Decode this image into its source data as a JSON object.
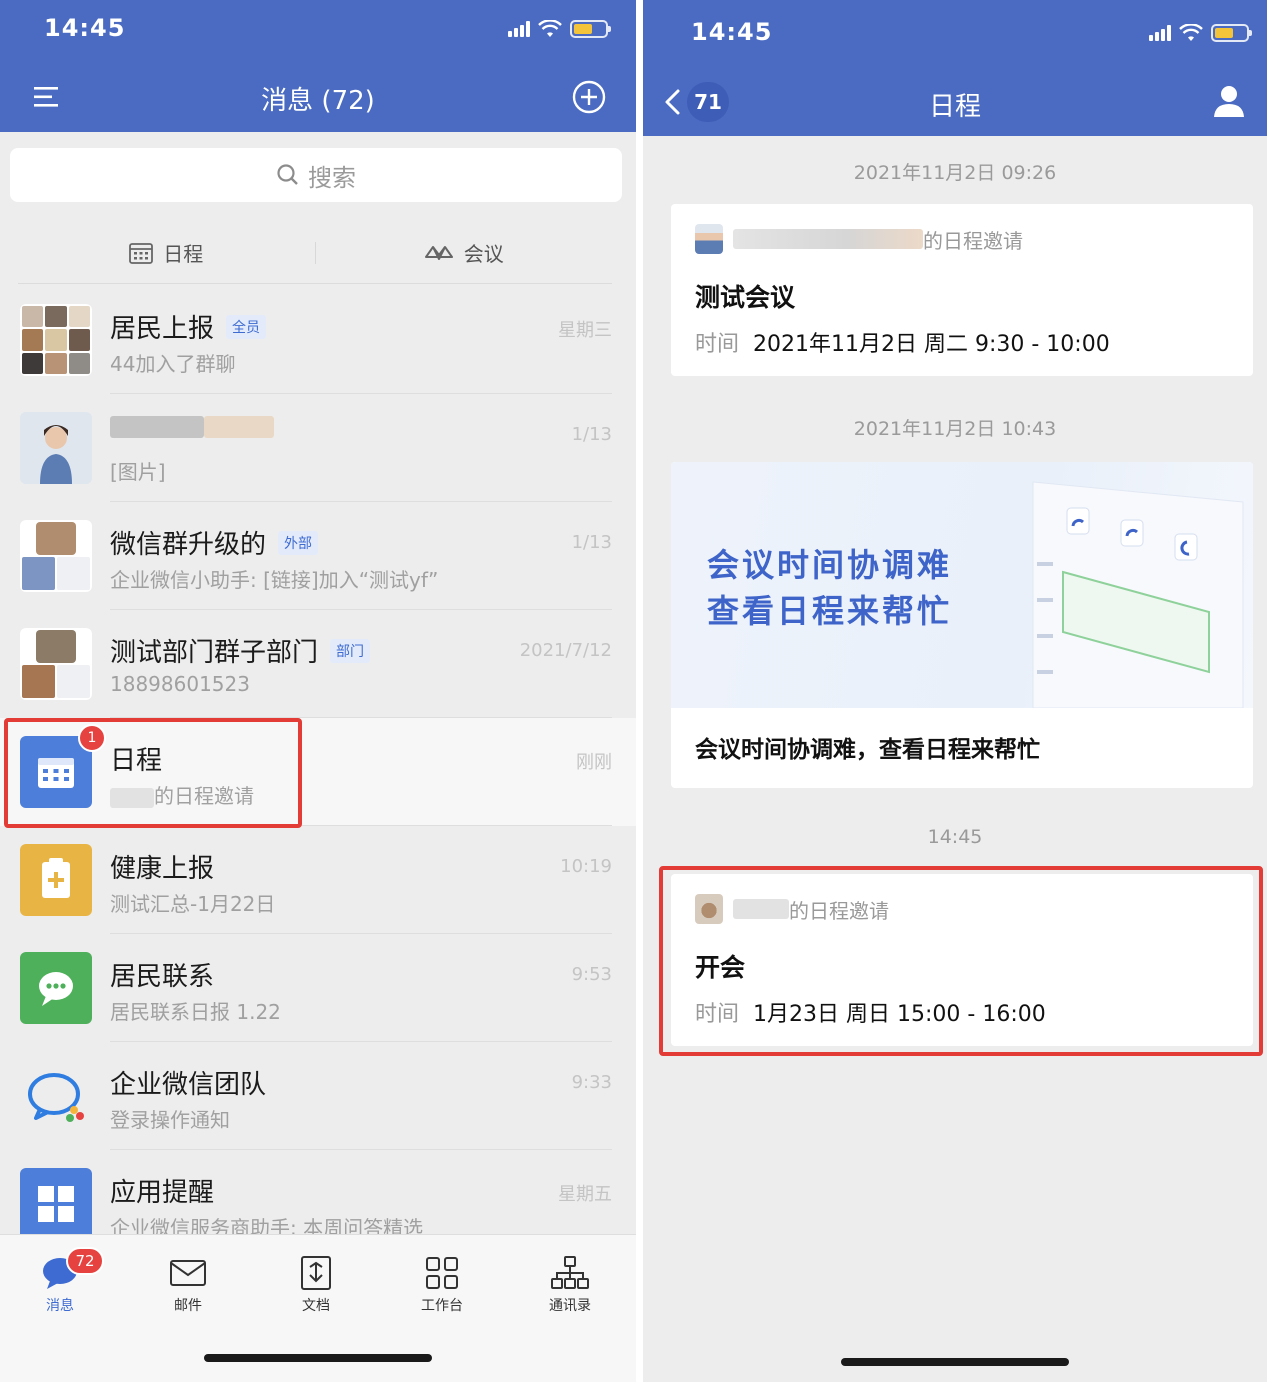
{
  "left": {
    "status_time": "14:45",
    "title": "消息 (72)",
    "search_placeholder": "搜索",
    "quick": [
      {
        "label": "日程"
      },
      {
        "label": "会议"
      }
    ],
    "chats": [
      {
        "title": "居民上报",
        "tag": "全员",
        "sub": "44加入了群聊",
        "time": "星期三"
      },
      {
        "title": "",
        "tag": "",
        "sub": "[图片]",
        "time": "1/13"
      },
      {
        "title": "微信群升级的",
        "tag": "外部",
        "sub": "企业微信小助手: [链接]加入“测试yf”",
        "time": "1/13"
      },
      {
        "title": "测试部门群子部门",
        "tag": "部门",
        "sub": "18898601523",
        "time": "2021/7/12"
      },
      {
        "title": "日程",
        "tag": "",
        "sub": "的日程邀请",
        "time": "刚刚",
        "badge": "1"
      },
      {
        "title": "健康上报",
        "tag": "",
        "sub": "测试汇总-1月22日",
        "time": "10:19"
      },
      {
        "title": "居民联系",
        "tag": "",
        "sub": "居民联系日报 1.22",
        "time": "9:53"
      },
      {
        "title": "企业微信团队",
        "tag": "",
        "sub": "登录操作通知",
        "time": "9:33"
      },
      {
        "title": "应用提醒",
        "tag": "",
        "sub": "企业微信服务商助手: 本周问答精选",
        "time": "星期五"
      }
    ],
    "tabs": [
      {
        "label": "消息",
        "badge": "72"
      },
      {
        "label": "邮件"
      },
      {
        "label": "文档"
      },
      {
        "label": "工作台"
      },
      {
        "label": "通讯录"
      }
    ],
    "colors": {
      "header": "#4a6bc1",
      "accent": "#3e6bd1",
      "badge": "#e64340",
      "highlight": "#e33c36"
    }
  },
  "right": {
    "status_time": "14:45",
    "title": "日程",
    "back_count": "71",
    "messages": [
      {
        "timestamp": "2021年11月2日 09:26",
        "head": "的日程邀请",
        "title": "测试会议",
        "time_label": "时间",
        "time": "2021年11月2日 周二 9:30 - 10:00"
      },
      {
        "timestamp": "2021年11月2日 10:43",
        "banner_line1": "会议时间协调难",
        "banner_line2": "查看日程来帮忙",
        "caption": "会议时间协调难，查看日程来帮忙"
      },
      {
        "timestamp": "14:45",
        "head": "的日程邀请",
        "title": "开会",
        "time_label": "时间",
        "time": "1月23日 周日 15:00 - 16:00"
      }
    ]
  }
}
